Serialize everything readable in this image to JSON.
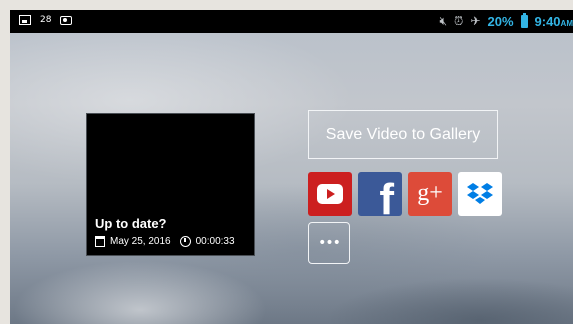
{
  "status_bar": {
    "left_icons": [
      "image-icon",
      "notification-count-text",
      "camera-icon"
    ],
    "notification_count": "28",
    "right_icons": [
      "mute-icon",
      "alarm-icon",
      "airplane-icon",
      "battery-icon"
    ],
    "battery_percent": "20%",
    "time": "9:40",
    "ampm": "AM",
    "accent_color": "#33b5e5"
  },
  "video": {
    "title": "Up to date?",
    "date": "May 25, 2016",
    "duration": "00:00:33"
  },
  "actions": {
    "save_label": "Save Video to Gallery",
    "share_targets": [
      {
        "name": "YouTube",
        "icon": "youtube-icon",
        "color": "#cc1f1f"
      },
      {
        "name": "Facebook",
        "icon": "facebook-icon",
        "color": "#3b5998",
        "glyph": "f"
      },
      {
        "name": "Google+",
        "icon": "google-plus-icon",
        "color": "#dd4b39",
        "glyph": "g+"
      },
      {
        "name": "Dropbox",
        "icon": "dropbox-icon",
        "color": "#007ee5"
      }
    ],
    "more_label": "•••"
  }
}
